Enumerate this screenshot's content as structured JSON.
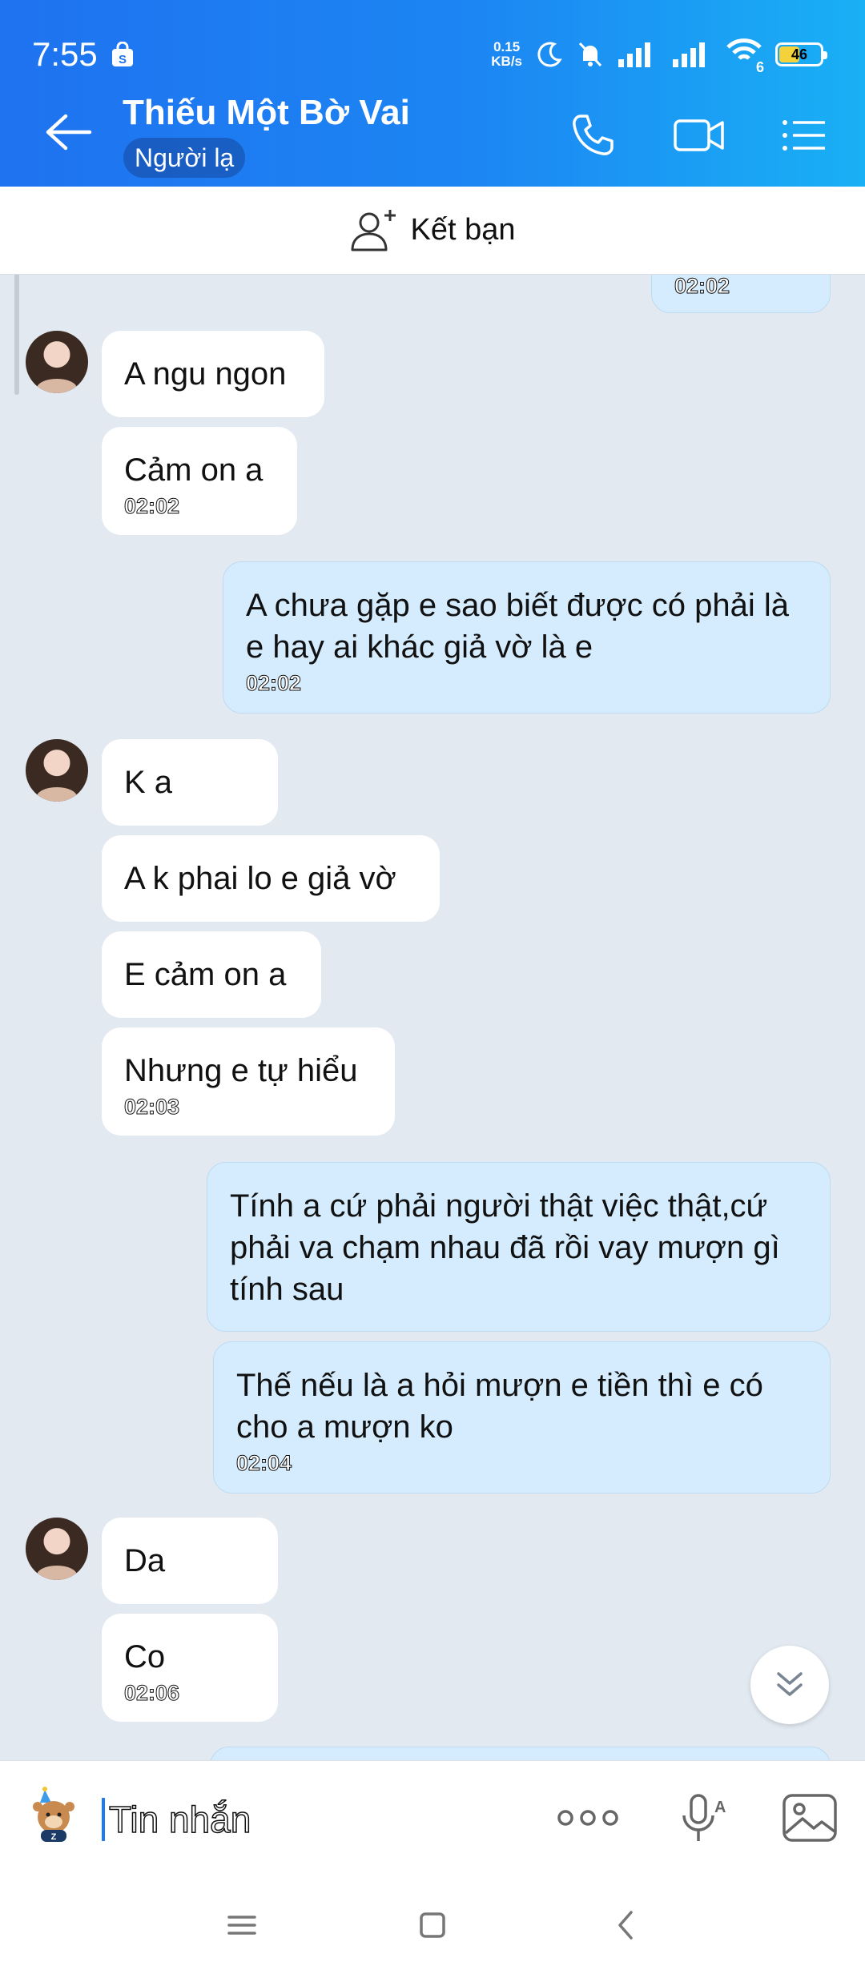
{
  "status_bar": {
    "time": "7:55",
    "net_speed_value": "0.15",
    "net_speed_unit": "KB/s",
    "wifi_badge": "6",
    "battery": "46"
  },
  "header": {
    "title": "Thiếu Một Bờ Vai",
    "badge": "Người lạ"
  },
  "friend_bar": {
    "label": "Kết bạn"
  },
  "messages": [
    {
      "side": "out",
      "text": "",
      "time": "02:02"
    },
    {
      "side": "in",
      "text": "A ngu ngon",
      "time": ""
    },
    {
      "side": "in",
      "text": "Cảm on a",
      "time": "02:02"
    },
    {
      "side": "out",
      "text": "A chưa gặp e sao biết được có phải là e hay ai khác giả vờ là e",
      "time": "02:02"
    },
    {
      "side": "in",
      "text": "K a",
      "time": ""
    },
    {
      "side": "in",
      "text": "A k phai lo e giả vờ",
      "time": ""
    },
    {
      "side": "in",
      "text": "E cảm on a",
      "time": ""
    },
    {
      "side": "in",
      "text": "Nhưng e tự hiểu",
      "time": "02:03"
    },
    {
      "side": "out",
      "text": "Tính a cứ phải người thật việc thật,cứ phải va chạm nhau đã rồi vay mượn gì tính sau",
      "time": ""
    },
    {
      "side": "out",
      "text": "Thế nếu là a hỏi mượn e tiền thì e có cho a mượn ko",
      "time": "02:04"
    },
    {
      "side": "in",
      "text": "Da",
      "time": ""
    },
    {
      "side": "in",
      "text": "Co",
      "time": "02:06"
    }
  ],
  "composer": {
    "placeholder": "Tin nhắn"
  },
  "colors": {
    "header_start": "#1f72f0",
    "header_end": "#19b0f5",
    "chat_background": "#e2e9f1",
    "outgoing_bubble": "#d4ecfe",
    "incoming_bubble": "#ffffff"
  },
  "icons": {
    "back": "arrow-left-icon",
    "call": "phone-icon",
    "video": "video-camera-icon",
    "menu": "list-icon",
    "add_friend": "user-plus-icon",
    "scroll_down": "double-chevron-down-icon",
    "sticker": "sticker-icon",
    "more": "more-dots-icon",
    "voice": "mic-icon",
    "image": "image-icon"
  }
}
